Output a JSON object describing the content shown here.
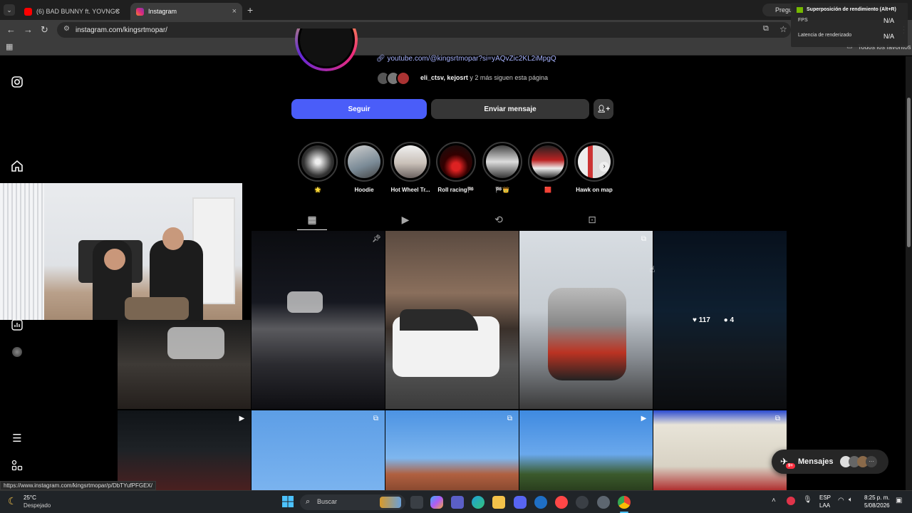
{
  "browser": {
    "tabs": [
      {
        "title": "(6) BAD BUNNY ft. YOVNGCHIMI",
        "active": false
      },
      {
        "title": "Instagram",
        "active": true
      }
    ],
    "new_tab_symbol": "+",
    "url": "instagram.com/kingsrtmopar/",
    "bookmarks_all": "Todos los favoritos",
    "ask_label": "Pregu"
  },
  "overlay": {
    "title": "Superposición de rendimiento (Alt+R)",
    "fps_label": "FPS",
    "fps_value": "N/A",
    "latency_label": "Latencia de renderizado",
    "latency_value": "N/A"
  },
  "profile": {
    "link": "youtube.com/@kingsrtmopar?si=yAQvZic2KL2iMpgQ",
    "followed_by_names": "eli_ctsv, kejosrt",
    "followed_by_rest": "y 2 más siguen esta página",
    "follow_button": "Seguir",
    "message_button": "Enviar mensaje"
  },
  "highlights": [
    {
      "label": "🌟"
    },
    {
      "label": "Hoodie"
    },
    {
      "label": "Hot Wheel Tr..."
    },
    {
      "label": "Roll racing🏁"
    },
    {
      "label": "🏁👑"
    },
    {
      "label": "🟥"
    },
    {
      "label": "Hawk on map"
    }
  ],
  "post_hover": {
    "likes": "117",
    "comments": "4"
  },
  "messages_label": "Mensajes",
  "messages_badge": "9+",
  "status_url": "https://www.instagram.com/kingsrtmopar/p/DbTYufPFGEX/",
  "weather": {
    "temp": "25°C",
    "desc": "Despejado"
  },
  "taskbar": {
    "search": "Buscar",
    "lang": "ESP",
    "layout": "LAA",
    "time": "8:25 p. m.",
    "date": "5/08/2026"
  },
  "colors": {
    "follow_blue": "#4a5df9",
    "secondary_btn": "#363636",
    "page_bg": "#000000"
  }
}
